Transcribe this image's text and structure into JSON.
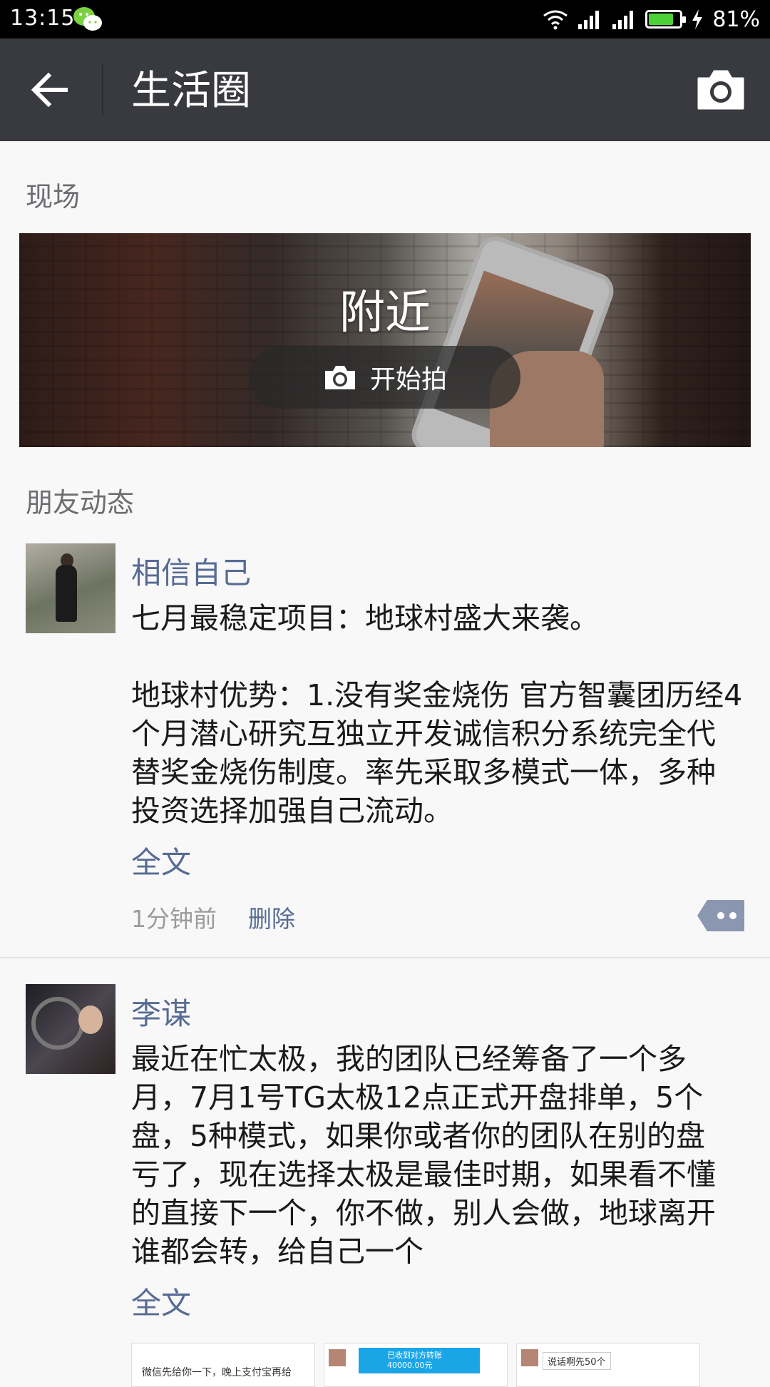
{
  "status_bar": {
    "time": "13:15",
    "battery_percent": "81%",
    "battery_level": 0.81,
    "battery_color": "#4cd137"
  },
  "header": {
    "title": "生活圈",
    "back_icon": "arrow-left-icon",
    "camera_icon": "camera-icon",
    "background": "#393a3f"
  },
  "live_section": {
    "label": "现场",
    "banner_title": "附近",
    "shoot_button_label": "开始拍"
  },
  "feed_section": {
    "label": "朋友动态",
    "posts": [
      {
        "username": "相信自己",
        "text": "七月最稳定项目：地球村盛大来袭。\n\n地球村优势：1.没有奖金烧伤 官方智囊团历经4个月潜心研究互独立开发诚信积分系统完全代替奖金烧伤制度。率先采取多模式一体，多种投资选择加强自己流动。",
        "full_text_link": "全文",
        "timestamp": "1分钟前",
        "delete_label": "删除"
      },
      {
        "username": "李谋",
        "text": "最近在忙太极，我的团队已经筹备了一个多月，7月1号TG太极12点正式开盘排单，5个盘，5种模式，如果你或者你的团队在别的盘亏了，现在选择太极是最佳时期，如果看不懂的直接下一个，你不做，别人会做，地球离开谁都会转，给自己一个",
        "full_text_link": "全文",
        "images": [
          {
            "caption": "微信先给你一下，晚上支付宝再给"
          },
          {
            "caption": "已收到对方转账 40000.00元"
          },
          {
            "caption": "说话啊先50个"
          }
        ]
      }
    ]
  },
  "colors": {
    "link": "#576b95",
    "page_bg": "#f8f8f8"
  }
}
